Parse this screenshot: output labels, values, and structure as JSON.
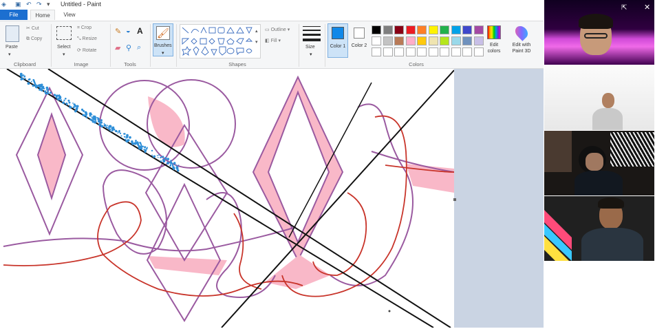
{
  "app": {
    "title": "Untitled - Paint",
    "tabs": [
      "File",
      "Home",
      "View"
    ]
  },
  "ribbon": {
    "clipboard": {
      "group": "Clipboard",
      "paste": "Paste",
      "cut": "Cut",
      "copy": "Copy"
    },
    "image": {
      "group": "Image",
      "select": "Select",
      "crop": "Crop",
      "resize": "Resize",
      "rotate": "Rotate"
    },
    "tools": {
      "group": "Tools"
    },
    "brushes": {
      "label": "Brushes"
    },
    "shapes": {
      "group": "Shapes",
      "outline": "Outline",
      "fill": "Fill"
    },
    "size": {
      "label": "Size"
    },
    "color1": {
      "label": "Color 1",
      "value": "#1088e8"
    },
    "color2": {
      "label": "Color 2",
      "value": "#ffffff"
    },
    "colors": {
      "group": "Colors",
      "edit": "Edit colors",
      "edit_paint3d": "Edit with Paint 3D"
    },
    "palette_row1": [
      "#000000",
      "#7f7f7f",
      "#880015",
      "#ed1c24",
      "#ff7f27",
      "#fff200",
      "#22b14c",
      "#00a2e8",
      "#3f48cc",
      "#a349a4"
    ],
    "palette_row2": [
      "#ffffff",
      "#c3c3c3",
      "#b97a57",
      "#ffaec9",
      "#ffc90e",
      "#efe4b0",
      "#b5e61d",
      "#99d9ea",
      "#7092be",
      "#c8bfe7"
    ]
  },
  "drawing": {
    "accent_pink": "#f9b8c8",
    "purple_stroke": "#9a5aa0",
    "red_stroke": "#c8342a",
    "blue_spray": "#2e8fd8"
  },
  "video_call": {
    "participants": [
      "participant-1",
      "participant-2",
      "participant-3",
      "participant-4"
    ]
  }
}
